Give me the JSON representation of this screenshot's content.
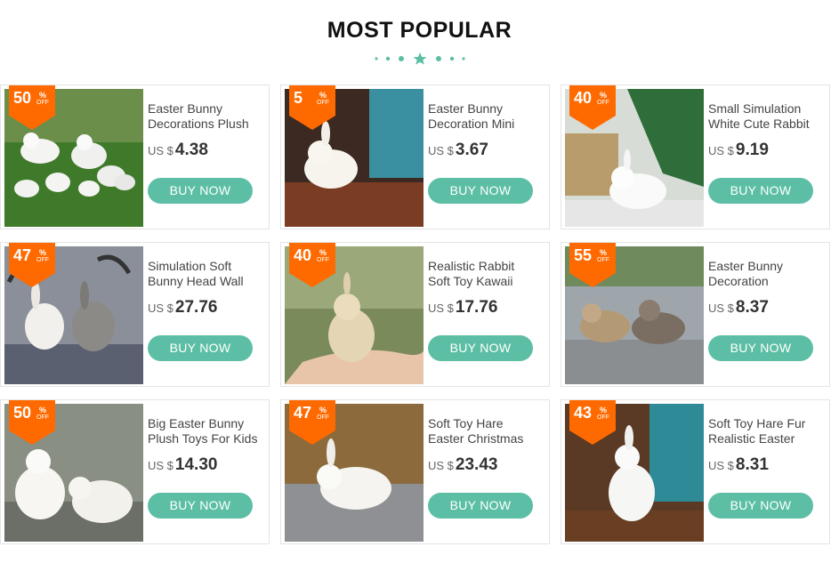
{
  "header": {
    "title": "MOST POPULAR",
    "accent_color": "#5cbfa5",
    "ornament_icon": "star-dots-divider"
  },
  "colors": {
    "badge": "#ff6a00",
    "button": "#5cbfa5"
  },
  "products": [
    {
      "discount": "50",
      "percent": "%",
      "off": "OFF",
      "name_line1": "Easter Bunny",
      "name_line2": "Decorations Plush",
      "currency": "US $",
      "price": "4.38",
      "button": "BUY NOW",
      "image": "rabbit-group-on-grass"
    },
    {
      "discount": "5",
      "percent": "%",
      "off": "OFF",
      "name_line1": "Easter Bunny",
      "name_line2": "Decoration Mini",
      "currency": "US $",
      "price": "3.67",
      "button": "BUY NOW",
      "image": "rabbit-on-wood-table-with-vase"
    },
    {
      "discount": "40",
      "percent": "%",
      "off": "OFF",
      "name_line1": "Small Simulation",
      "name_line2": "White Cute Rabbit",
      "currency": "US $",
      "price": "9.19",
      "button": "BUY NOW",
      "image": "white-rabbit-with-plants"
    },
    {
      "discount": "47",
      "percent": "%",
      "off": "OFF",
      "name_line1": "Simulation Soft",
      "name_line2": "Bunny Head Wall",
      "currency": "US $",
      "price": "27.76",
      "button": "BUY NOW",
      "image": "rabbit-heads-with-antlers"
    },
    {
      "discount": "40",
      "percent": "%",
      "off": "OFF",
      "name_line1": "Realistic Rabbit",
      "name_line2": "Soft Toy Kawaii",
      "currency": "US $",
      "price": "17.76",
      "button": "BUY NOW",
      "image": "rabbit-in-hand"
    },
    {
      "discount": "55",
      "percent": "%",
      "off": "OFF",
      "name_line1": "Easter Bunny",
      "name_line2": "Decoration",
      "currency": "US $",
      "price": "8.37",
      "button": "BUY NOW",
      "image": "brown-rabbits-on-rock"
    },
    {
      "discount": "50",
      "percent": "%",
      "off": "OFF",
      "name_line1": "Big Easter Bunny",
      "name_line2": "Plush Toys For Kids",
      "currency": "US $",
      "price": "14.30",
      "button": "BUY NOW",
      "image": "white-rabbits-on-stone"
    },
    {
      "discount": "47",
      "percent": "%",
      "off": "OFF",
      "name_line1": "Soft Toy Hare",
      "name_line2": "Easter Christmas",
      "currency": "US $",
      "price": "23.43",
      "button": "BUY NOW",
      "image": "white-hare-on-stone"
    },
    {
      "discount": "43",
      "percent": "%",
      "off": "OFF",
      "name_line1": "Soft Toy Hare Fur",
      "name_line2": "Realistic Easter",
      "currency": "US $",
      "price": "8.31",
      "button": "BUY NOW",
      "image": "white-hare-with-vase"
    }
  ]
}
